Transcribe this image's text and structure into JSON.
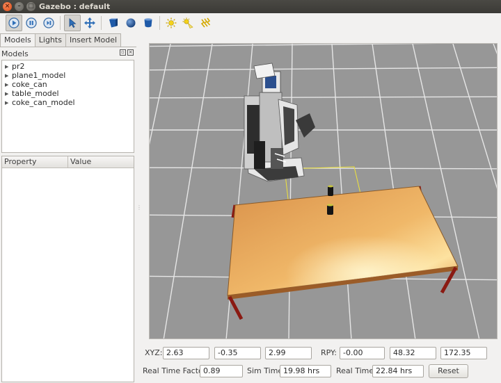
{
  "window": {
    "title": "Gazebo : default"
  },
  "toolbar": {
    "buttons": [
      "play",
      "pause",
      "step",
      "select-mode",
      "translate-mode",
      "box",
      "sphere",
      "cylinder",
      "point-light",
      "spot-light",
      "directional-light"
    ]
  },
  "tabs": [
    {
      "label": "Models",
      "active": true
    },
    {
      "label": "Lights",
      "active": false
    },
    {
      "label": "Insert Model",
      "active": false
    }
  ],
  "models_panel": {
    "header": "Models",
    "items": [
      "pr2",
      "plane1_model",
      "coke_can",
      "table_model",
      "coke_can_model"
    ]
  },
  "property_table": {
    "col_property": "Property",
    "col_value": "Value"
  },
  "pose": {
    "xyz_label": "XYZ:",
    "x": "2.63",
    "y": "-0.35",
    "z": "2.99",
    "rpy_label": "RPY:",
    "roll": "-0.00",
    "pitch": "48.32",
    "yaw": "172.35"
  },
  "time": {
    "rtf_label": "Real Time Factor:",
    "rtf": "0.89",
    "sim_label": "Sim Time:",
    "sim": "19.98 hrs",
    "real_label": "Real Time:",
    "real": "22.84 hrs",
    "reset_label": "Reset"
  },
  "colors": {
    "accent": "#2f6fb8",
    "ground": "#9a9a9a",
    "table_top": "#e8a857",
    "table_legs": "#8a1a12"
  }
}
